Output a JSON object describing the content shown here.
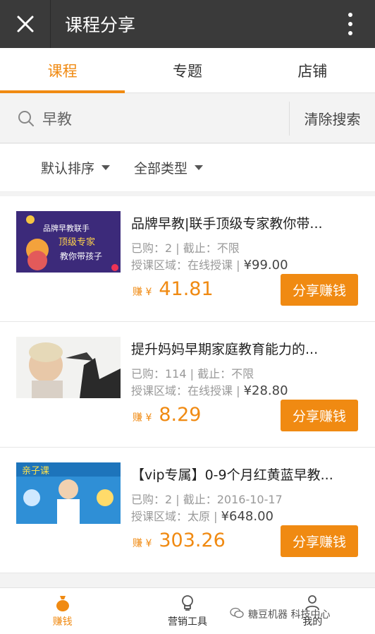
{
  "header": {
    "title": "课程分享"
  },
  "tabs": [
    {
      "label": "课程",
      "active": true
    },
    {
      "label": "专题",
      "active": false
    },
    {
      "label": "店铺",
      "active": false
    }
  ],
  "search": {
    "value": "早教",
    "clear_label": "清除搜索"
  },
  "filters": [
    {
      "label": "默认排序"
    },
    {
      "label": "全部类型"
    }
  ],
  "items": [
    {
      "title": "品牌早教|联手顶级专家教你带...",
      "sold": "已购：2",
      "deadline": "截止：不限",
      "area": "授课区域：在线授课",
      "price": "¥99.00",
      "earn_label": "赚 ¥",
      "earn": "41.81",
      "button": "分享赚钱",
      "thumb_text": [
        "品牌早教联手",
        "顶级专家",
        "教你带孩子"
      ]
    },
    {
      "title": "提升妈妈早期家庭教育能力的...",
      "sold": "已购：114",
      "deadline": "截止：不限",
      "area": "授课区域：在线授课",
      "price": "¥28.80",
      "earn_label": "赚 ¥",
      "earn": "8.29",
      "button": "分享赚钱"
    },
    {
      "title": "【vip专属】0-9个月红黄蓝早教...",
      "sold": "已购：2",
      "deadline": "截止：2016-10-17",
      "area": "授课区域：太原",
      "price": "¥648.00",
      "earn_label": "赚 ¥",
      "earn": "303.26",
      "button": "分享赚钱",
      "thumb_text": [
        "亲子课"
      ]
    }
  ],
  "nav": [
    {
      "label": "赚钱",
      "active": true
    },
    {
      "label": "营销工具",
      "active": false
    },
    {
      "label": "我的",
      "active": false
    }
  ],
  "watermark": "糖豆机器 科技中心",
  "colors": {
    "accent": "#f08a12",
    "topbar": "#3a3a3a"
  }
}
